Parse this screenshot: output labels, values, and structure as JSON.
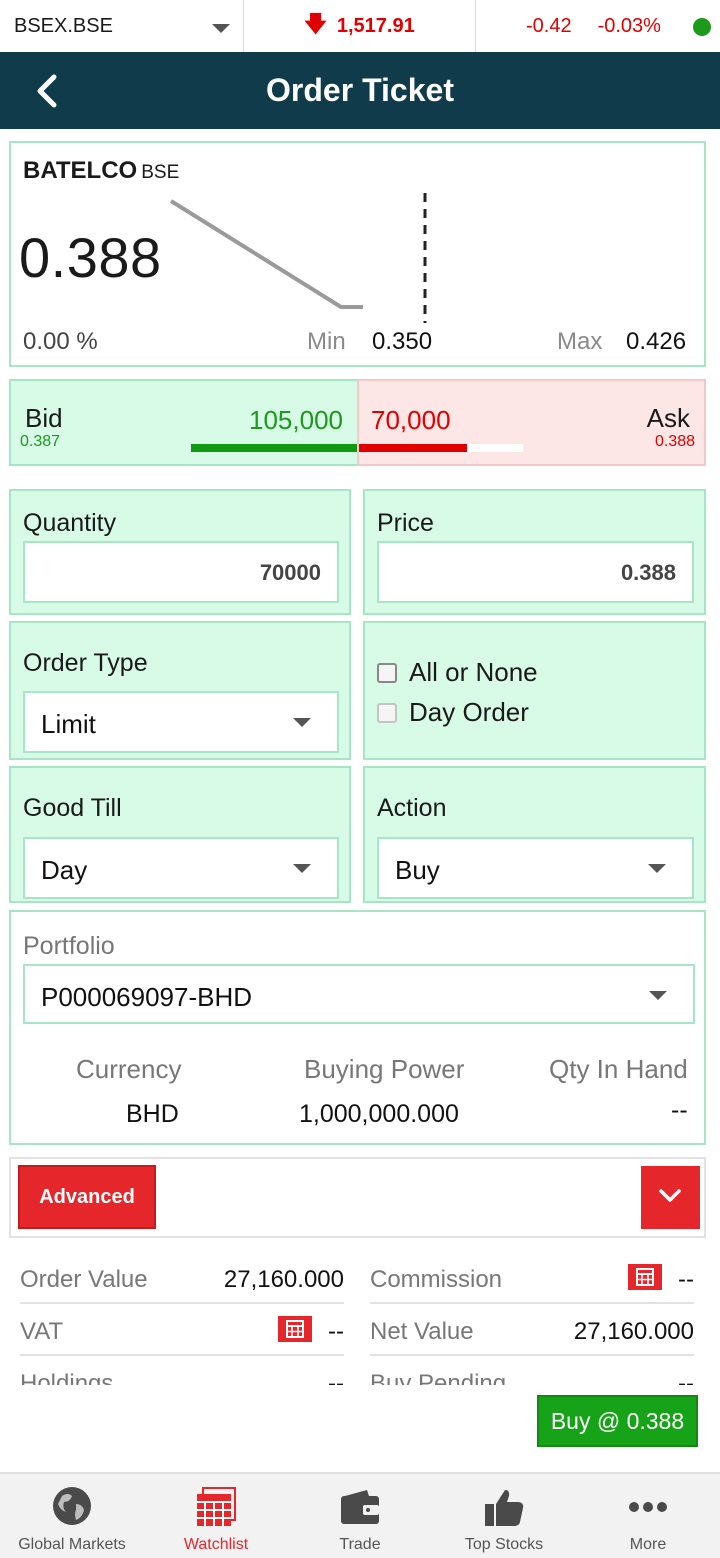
{
  "market": {
    "symbol": "BSEX.BSE",
    "index_value": "1,517.91",
    "change": "-0.42",
    "change_pct": "-0.03%",
    "status_color": "#1c9a1c"
  },
  "header": {
    "title": "Order Ticket"
  },
  "stock": {
    "symbol": "BATELCO",
    "exchange": "BSE",
    "price": "0.388",
    "change_pct": "0.00 %",
    "min_label": "Min",
    "min_value": "0.350",
    "max_label": "Max",
    "max_value": "0.426"
  },
  "depth": {
    "bid_label": "Bid",
    "bid_price": "0.387",
    "bid_volume": "105,000",
    "ask_label": "Ask",
    "ask_price": "0.388",
    "ask_volume": "70,000"
  },
  "form": {
    "quantity_label": "Quantity",
    "quantity_value": "70000",
    "price_label": "Price",
    "price_value": "0.388",
    "order_type_label": "Order Type",
    "order_type_value": "Limit",
    "all_or_none_label": "All or None",
    "day_order_label": "Day Order",
    "good_till_label": "Good Till",
    "good_till_value": "Day",
    "action_label": "Action",
    "action_value": "Buy"
  },
  "portfolio": {
    "label": "Portfolio",
    "value": "P000069097-BHD",
    "currency_label": "Currency",
    "currency_value": "BHD",
    "buying_power_label": "Buying Power",
    "buying_power_value": "1,000,000.000",
    "qty_in_hand_label": "Qty In Hand",
    "qty_in_hand_value": "--"
  },
  "advanced": {
    "label": "Advanced"
  },
  "summary": {
    "order_value_label": "Order Value",
    "order_value": "27,160.000",
    "commission_label": "Commission",
    "commission_value": "--",
    "vat_label": "VAT",
    "vat_value": "--",
    "net_value_label": "Net Value",
    "net_value": "27,160.000",
    "holdings_label": "Holdings",
    "holdings_value": "--",
    "buy_pending_label": "Buy Pending",
    "buy_pending_value": "--"
  },
  "buy_button": {
    "label": "Buy @ 0.388"
  },
  "nav": {
    "items": [
      {
        "label": "Global Markets",
        "icon": "globe-icon"
      },
      {
        "label": "Watchlist",
        "icon": "calendar-grid-icon"
      },
      {
        "label": "Trade",
        "icon": "wallet-icon"
      },
      {
        "label": "Top Stocks",
        "icon": "thumbs-up-icon"
      },
      {
        "label": "More",
        "icon": "more-dots-icon"
      }
    ],
    "active_color": "#e5262a"
  }
}
